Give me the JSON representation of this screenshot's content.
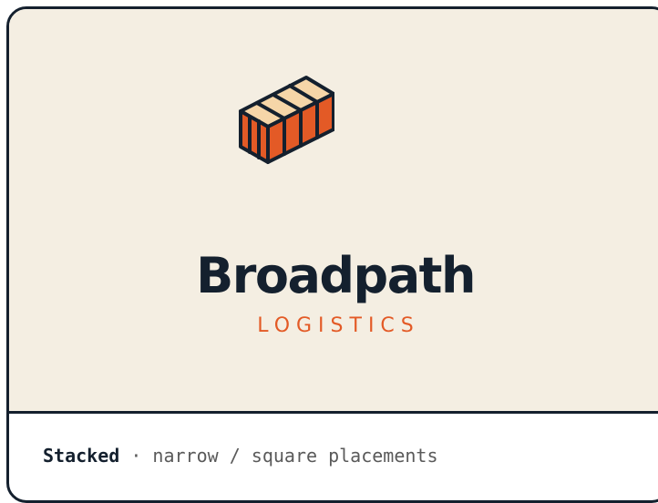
{
  "brand": {
    "name": "Broadpath",
    "tagline": "LOGISTICS"
  },
  "caption": {
    "variant": "Stacked",
    "separator": " · ",
    "description": "narrow / square placements"
  },
  "colors": {
    "ink": "#14202e",
    "accent": "#e35a26",
    "cream": "#f4eee2",
    "container_top": "#f6d6a8"
  },
  "logo_icon": "shipping-container-icon"
}
